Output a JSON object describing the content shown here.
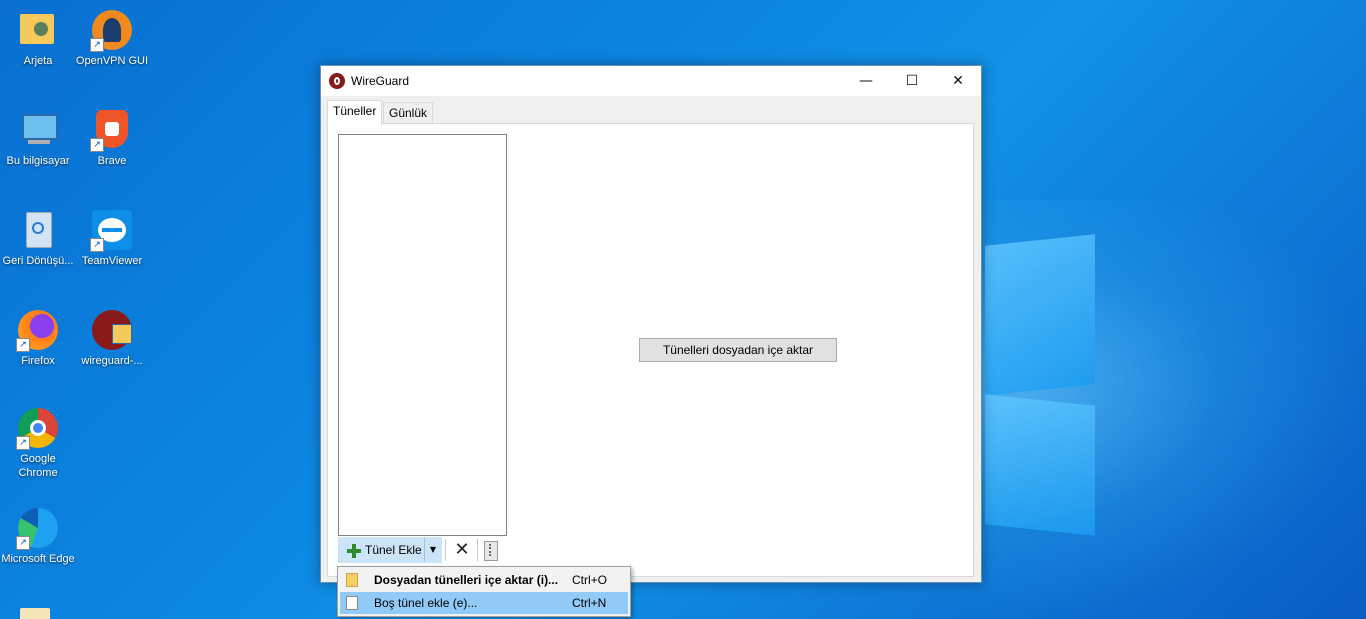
{
  "desktop": {
    "icons": [
      {
        "label": "Arjeta",
        "icon": "user-folder-icon"
      },
      {
        "label": "OpenVPN GUI",
        "icon": "openvpn-icon"
      },
      {
        "label": "Bu bilgisayar",
        "icon": "computer-icon"
      },
      {
        "label": "Brave",
        "icon": "brave-icon"
      },
      {
        "label": "Geri Dönüşü...",
        "icon": "recycle-bin-icon"
      },
      {
        "label": "TeamViewer",
        "icon": "teamviewer-icon"
      },
      {
        "label": "Firefox",
        "icon": "firefox-icon"
      },
      {
        "label": "wireguard-...",
        "icon": "wireguard-installer-icon"
      },
      {
        "label": "Google Chrome",
        "icon": "chrome-icon"
      },
      {
        "label": "Microsoft Edge",
        "icon": "edge-icon"
      }
    ]
  },
  "window": {
    "title": "WireGuard",
    "minimize": "—",
    "maximize": "☐",
    "close": "✕"
  },
  "tabs": [
    {
      "label": "Tüneller",
      "active": true
    },
    {
      "label": "Günlük",
      "active": false
    }
  ],
  "main": {
    "import_button": "Tünelleri dosyadan içe aktar"
  },
  "toolbar": {
    "add_tunnel": "Tünel Ekle",
    "dropdown_arrow": "▼",
    "delete": "✕"
  },
  "menu": {
    "items": [
      {
        "label": "Dosyadan tünelleri içe aktar (i)...",
        "shortcut": "Ctrl+O",
        "icon": "folder-icon",
        "bold": true
      },
      {
        "label": "Boş tünel ekle (e)...",
        "shortcut": "Ctrl+N",
        "icon": "file-icon",
        "highlighted": true
      }
    ]
  }
}
